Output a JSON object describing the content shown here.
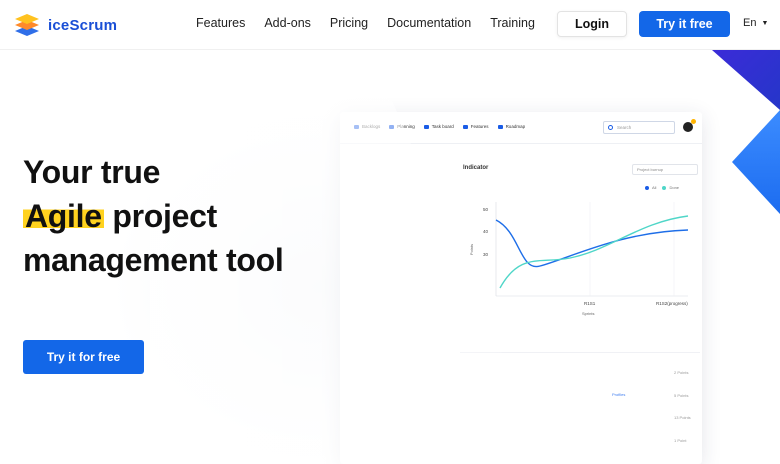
{
  "brand": {
    "name": "iceScrum",
    "accent": "#1367e8",
    "highlight": "#ffd21f"
  },
  "nav": {
    "items": [
      "Features",
      "Add-ons",
      "Pricing",
      "Documentation",
      "Training"
    ],
    "login_label": "Login",
    "try_label": "Try it free",
    "language": "En"
  },
  "hero": {
    "line1": "Your true",
    "highlight_word": "Agile",
    "line2_rest": "project",
    "line3": "management tool",
    "cta_label": "Try it for free"
  },
  "mockup": {
    "tabs": [
      "Backlogs",
      "Planning",
      "Task board",
      "Features",
      "Roadmap"
    ],
    "search_placeholder": "Search",
    "indicator_title": "Indicator",
    "indicator_select": "Project burnup",
    "legend": [
      {
        "label": "All",
        "color": "#1a5ce6"
      },
      {
        "label": "Done",
        "color": "#4fd6c8"
      }
    ],
    "y_label": "Points",
    "x_label": "Sprints",
    "y_ticks": [
      "50",
      "40",
      "30"
    ],
    "x_ticks": [
      "R1S1",
      "R1S2(progress)"
    ],
    "row_link": "Profiles",
    "side_labels": [
      "2 Points",
      "5 Points",
      "13 Points",
      "1 Point"
    ]
  }
}
